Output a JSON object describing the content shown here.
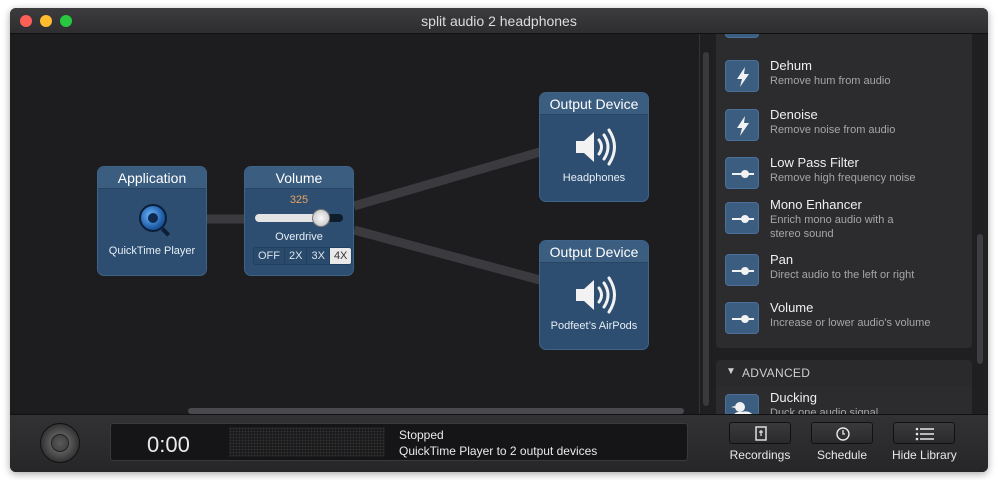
{
  "window": {
    "title": "split audio 2 headphones"
  },
  "nodes": {
    "application": {
      "header": "Application",
      "caption": "QuickTime Player",
      "icon": "quicktime-icon"
    },
    "volume": {
      "header": "Volume",
      "value": "325",
      "slider_fraction": 0.75,
      "overdrive_label": "Overdrive",
      "overdrive_options": [
        "OFF",
        "2X",
        "3X",
        "4X"
      ],
      "overdrive_selected": "4X"
    },
    "output1": {
      "header": "Output Device",
      "caption": "Headphones",
      "icon": "speaker-icon"
    },
    "output2": {
      "header": "Output Device",
      "caption": "Podfeet’s AirPods",
      "icon": "speaker-icon"
    }
  },
  "library": {
    "items": [
      {
        "name": "Dehum",
        "desc": "Remove hum from audio",
        "icon": "lightning-icon"
      },
      {
        "name": "Denoise",
        "desc": "Remove noise from audio",
        "icon": "lightning-icon"
      },
      {
        "name": "Low Pass Filter",
        "desc": "Remove high frequency noise",
        "icon": "slider-icon"
      },
      {
        "name": "Mono Enhancer",
        "desc": "Enrich mono audio with a stereo sound",
        "icon": "slider-icon"
      },
      {
        "name": "Pan",
        "desc": "Direct audio to the left or right",
        "icon": "slider-icon"
      },
      {
        "name": "Volume",
        "desc": "Increase or lower audio's volume",
        "icon": "slider-icon"
      }
    ],
    "advanced": {
      "header": "ADVANCED",
      "items": [
        {
          "name": "Ducking",
          "desc": "Duck one audio signal",
          "icon": "duck-icon"
        }
      ]
    }
  },
  "footer": {
    "time": "0:00",
    "status": "Stopped",
    "detail": "QuickTime Player to 2 output devices",
    "buttons": {
      "recordings": "Recordings",
      "schedule": "Schedule",
      "hide_library": "Hide Library"
    }
  },
  "colors": {
    "node_fill": "#2d4e70",
    "node_header": "#3a5d80",
    "volume_value": "#e8a15c",
    "canvas_bg": "#1d1d20"
  }
}
